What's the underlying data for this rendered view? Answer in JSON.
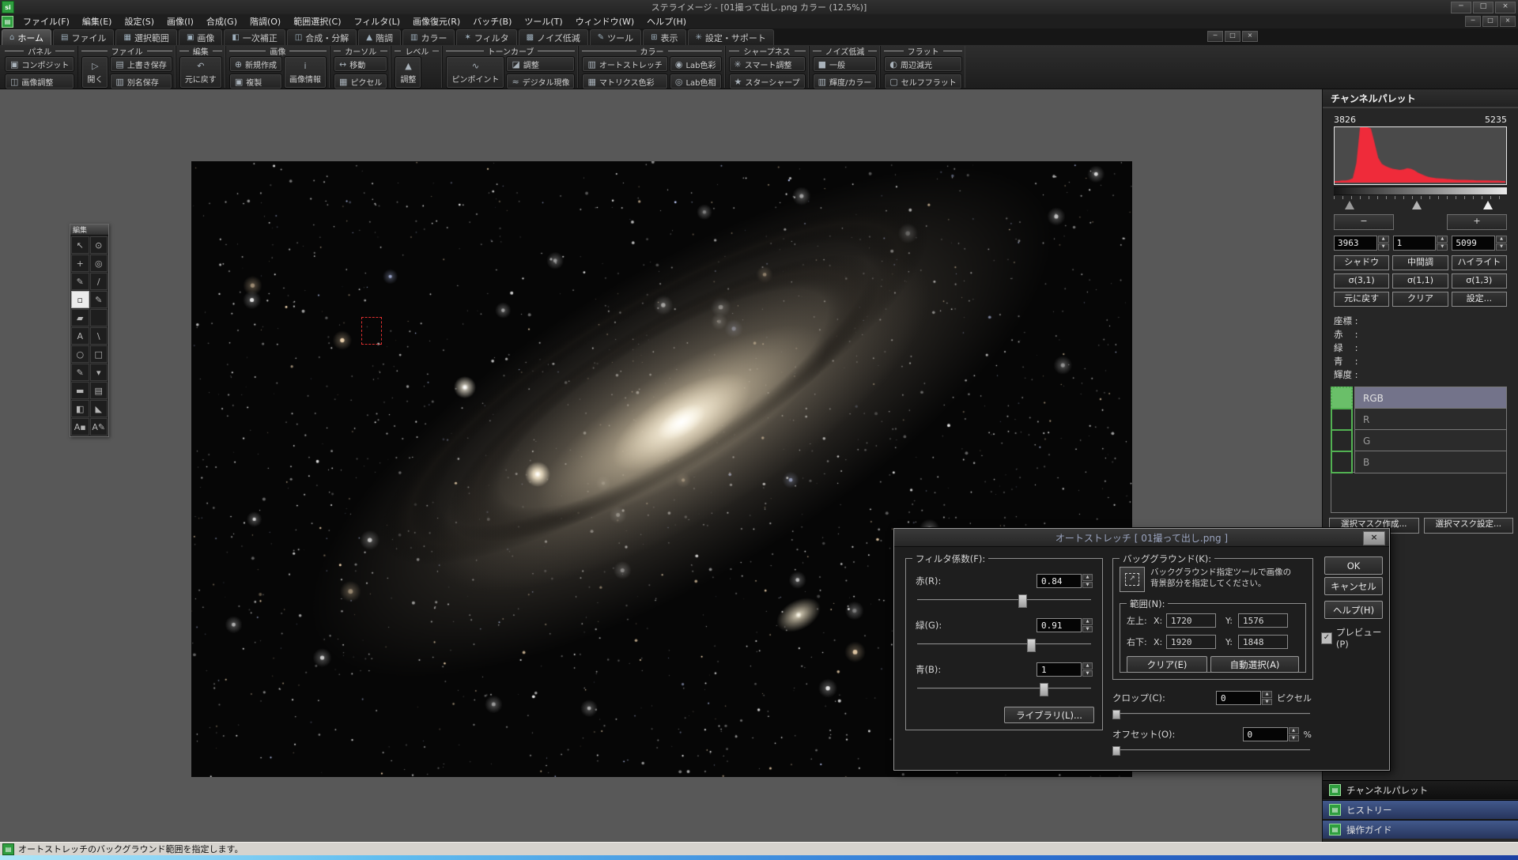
{
  "window": {
    "title": "ステライメージ - [01撮って出し.png カラー (12.5%)]",
    "app_icon": "si",
    "minimize": "─",
    "maximize": "□",
    "close": "×"
  },
  "menu": {
    "items": [
      "ファイル(F)",
      "編集(E)",
      "設定(S)",
      "画像(I)",
      "合成(G)",
      "階調(O)",
      "範囲選択(C)",
      "フィルタ(L)",
      "画像復元(R)",
      "バッチ(B)",
      "ツール(T)",
      "ウィンドウ(W)",
      "ヘルプ(H)"
    ]
  },
  "tabs": [
    {
      "icon": "⌂",
      "label": "ホーム",
      "active": true
    },
    {
      "icon": "▤",
      "label": "ファイル",
      "active": false
    },
    {
      "icon": "▦",
      "label": "選択範囲",
      "active": false
    },
    {
      "icon": "▣",
      "label": "画像",
      "active": false
    },
    {
      "icon": "◧",
      "label": "一次補正",
      "active": false
    },
    {
      "icon": "◫",
      "label": "合成・分解",
      "active": false
    },
    {
      "icon": "▲",
      "label": "階調",
      "active": false
    },
    {
      "icon": "▥",
      "label": "カラー",
      "active": false
    },
    {
      "icon": "✶",
      "label": "フィルタ",
      "active": false
    },
    {
      "icon": "▩",
      "label": "ノイズ低減",
      "active": false
    },
    {
      "icon": "✎",
      "label": "ツール",
      "active": false
    },
    {
      "icon": "⊞",
      "label": "表示",
      "active": false
    },
    {
      "icon": "✳",
      "label": "設定・サポート",
      "active": false
    }
  ],
  "ribbon": {
    "groups": [
      {
        "label": "パネル",
        "cols": [
          {
            "stack": [
              {
                "icon": "▣",
                "label": "コンポジット"
              },
              {
                "icon": "◫",
                "label": "画像調整"
              }
            ]
          }
        ]
      },
      {
        "label": "ファイル",
        "cols": [
          {
            "tall": {
              "icon": "▷",
              "label": "開く"
            }
          },
          {
            "stack": [
              {
                "icon": "▤",
                "label": "上書き保存"
              },
              {
                "icon": "▥",
                "label": "別名保存"
              }
            ]
          }
        ]
      },
      {
        "label": "編集",
        "cols": [
          {
            "tall": {
              "icon": "↶",
              "label": "元に戻す"
            }
          }
        ]
      },
      {
        "label": "画像",
        "cols": [
          {
            "stack": [
              {
                "icon": "⊕",
                "label": "新規作成"
              },
              {
                "icon": "▣",
                "label": "複製"
              }
            ]
          },
          {
            "tall": {
              "icon": "i",
              "label": "画像情報"
            }
          }
        ]
      },
      {
        "label": "カーソル",
        "cols": [
          {
            "stack": [
              {
                "icon": "↔",
                "label": "移動"
              },
              {
                "icon": "▦",
                "label": "ピクセル"
              }
            ]
          }
        ]
      },
      {
        "label": "レベル",
        "cols": [
          {
            "tall": {
              "icon": "▲",
              "label": "調整"
            }
          }
        ]
      },
      {
        "label": "トーンカーブ",
        "cols": [
          {
            "tall": {
              "icon": "∿",
              "label": "ピンポイント"
            }
          },
          {
            "stack": [
              {
                "icon": "◪",
                "label": "調整"
              },
              {
                "icon": "≈",
                "label": "デジタル現像"
              }
            ]
          }
        ]
      },
      {
        "label": "カラー",
        "cols": [
          {
            "stack": [
              {
                "icon": "▥",
                "label": "オートストレッチ"
              },
              {
                "icon": "▦",
                "label": "マトリクス色彩"
              }
            ]
          },
          {
            "stack": [
              {
                "icon": "◉",
                "label": "Lab色彩"
              },
              {
                "icon": "◎",
                "label": "Lab色相"
              }
            ]
          }
        ]
      },
      {
        "label": "シャープネス",
        "cols": [
          {
            "stack": [
              {
                "icon": "✳",
                "label": "スマート調整"
              },
              {
                "icon": "★",
                "label": "スターシャープ"
              }
            ]
          }
        ]
      },
      {
        "label": "ノイズ低減",
        "cols": [
          {
            "stack": [
              {
                "icon": "■",
                "label": "一般"
              },
              {
                "icon": "▥",
                "label": "輝度/カラー"
              }
            ]
          }
        ]
      },
      {
        "label": "フラット",
        "cols": [
          {
            "stack": [
              {
                "icon": "◐",
                "label": "周辺減光"
              },
              {
                "icon": "▢",
                "label": "セルフフラット"
              }
            ]
          }
        ]
      }
    ]
  },
  "tool_palette": {
    "title": "編集",
    "tools": [
      [
        "↖",
        "⊙"
      ],
      [
        "+",
        "◎"
      ],
      [
        "✎",
        "/"
      ],
      [
        "▫",
        "✎"
      ],
      [
        "▰",
        ""
      ],
      [
        "A",
        "\\"
      ],
      [
        "○",
        "□"
      ],
      [
        "✎",
        "▾"
      ],
      [
        "▬",
        "▤"
      ],
      [
        "◧",
        "◣"
      ],
      [
        "A▪",
        "A✎"
      ]
    ],
    "selected_row": 3,
    "selected_col": 0
  },
  "channel_palette": {
    "title": "チャンネルパレット",
    "histogram": {
      "min_label": "3826",
      "max_label": "5235",
      "color": "#ef2b3a",
      "values": [
        0.03,
        0.03,
        0.04,
        0.04,
        0.05,
        0.08,
        0.35,
        1,
        1,
        1,
        0.98,
        0.72,
        0.45,
        0.34,
        0.3,
        0.27,
        0.25,
        0.24,
        0.23,
        0.24,
        0.26,
        0.25,
        0.22,
        0.18,
        0.15,
        0.12,
        0.1,
        0.09,
        0.08,
        0.075,
        0.07,
        0.065,
        0.06,
        0.055,
        0.05,
        0.05,
        0.05,
        0.045,
        0.045,
        0.04,
        0.04,
        0.04,
        0.04,
        0.035,
        0.035,
        0.035,
        0.03,
        0.03
      ],
      "markers_pct": [
        9,
        48,
        89
      ]
    },
    "minus": "−",
    "plus": "+",
    "spinners": [
      "3963",
      "1",
      "5099"
    ],
    "range_buttons": [
      "シャドウ",
      "中間調",
      "ハイライト"
    ],
    "sigma_buttons": [
      "σ(3,1)",
      "σ(1,1)",
      "σ(1,3)"
    ],
    "action_buttons": [
      "元に戻す",
      "クリア",
      "設定..."
    ],
    "coord_labels": [
      "座標 :",
      "赤　 :",
      "緑　 :",
      "青　 :",
      "輝度 :"
    ],
    "channels": [
      {
        "label": "RGB",
        "selected": true
      },
      {
        "label": "R",
        "selected": false
      },
      {
        "label": "G",
        "selected": false
      },
      {
        "label": "B",
        "selected": false
      }
    ],
    "mask_buttons": [
      "選択マスク作成...",
      "選択マスク設定..."
    ]
  },
  "dialog": {
    "title": "オートストレッチ [ 01撮って出し.png ]",
    "close": "×",
    "filter_group": {
      "label": "フィルタ係数(F):",
      "rows": [
        {
          "label": "赤(R):",
          "value": "0.84",
          "pos": 58
        },
        {
          "label": "緑(G):",
          "value": "0.91",
          "pos": 63
        },
        {
          "label": "青(B):",
          "value": "1",
          "pos": 70
        }
      ],
      "library": "ライブラリ(L)..."
    },
    "bg_group": {
      "label": "バッググラウンド(K):",
      "hint1": "バックグラウンド指定ツールで画像の",
      "hint2": "背景部分を指定してください。",
      "range_label": "範囲(N):",
      "rows": [
        {
          "label": "左上:",
          "x_label": "X:",
          "x": "1720",
          "y_label": "Y:",
          "y": "1576"
        },
        {
          "label": "右下:",
          "x_label": "X:",
          "x": "1920",
          "y_label": "Y:",
          "y": "1848"
        }
      ],
      "clear": "クリア(E)",
      "auto": "自動選択(A)"
    },
    "crop": {
      "label": "クロップ(C):",
      "value": "0",
      "unit": "ピクセル"
    },
    "offset": {
      "label": "オフセット(O):",
      "value": "0",
      "unit": "%"
    },
    "ok": "OK",
    "cancel": "キャンセル",
    "help": "ヘルプ(H)",
    "preview": "プレビュー(P)",
    "preview_checked": "✓"
  },
  "dock": {
    "items": [
      {
        "icon": "▤",
        "label": "チャンネルパレット",
        "highlight": false
      },
      {
        "icon": "▤",
        "label": "ヒストリー",
        "highlight": true
      },
      {
        "icon": "▤",
        "label": "操作ガイド",
        "highlight": true
      }
    ]
  },
  "status": {
    "text": "オートストレッチのバックグラウンド範囲を指定します。"
  },
  "colors": {
    "hist_red": "#ef2b3a",
    "green_icon": "#2f9e3f",
    "selection_red": "#e03030",
    "dock_blue": "#42598c",
    "canvas_gray": "#585858"
  }
}
